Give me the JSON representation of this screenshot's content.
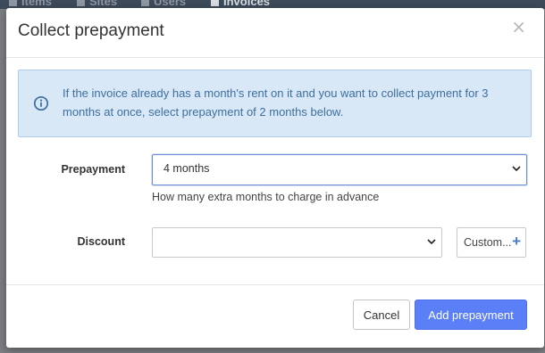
{
  "background": {
    "tabs": [
      "Items",
      "Sites",
      "Users",
      "Invoices"
    ],
    "active_tab": "Invoices"
  },
  "modal": {
    "title": "Collect prepayment",
    "close_symbol": "×",
    "alert": {
      "icon": "info-circle-icon",
      "text": "If the invoice already has a month's rent on it and you want to collect payment for 3 months at once, select prepayment of 2 months below."
    },
    "prepayment": {
      "label": "Prepayment",
      "value": "4 months",
      "help": "How many extra months to charge in advance"
    },
    "discount": {
      "label": "Discount",
      "value": "",
      "custom_button": "Custom...",
      "custom_icon": "+"
    },
    "footer": {
      "cancel_label": "Cancel",
      "submit_label": "Add prepayment"
    }
  },
  "colors": {
    "primary": "#5b7ff6",
    "alert_bg": "#d9e8f6",
    "alert_text": "#3e6f9e",
    "overlay": "#7d7f83"
  }
}
